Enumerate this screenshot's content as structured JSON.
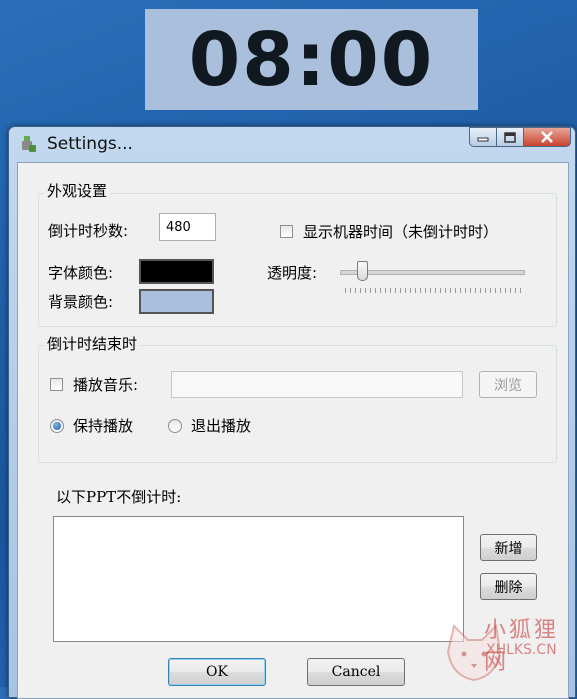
{
  "countdown": {
    "time": "08:00"
  },
  "window": {
    "title": "Settings...",
    "appearance": {
      "group_label": "外观设置",
      "seconds_label": "倒计时秒数:",
      "seconds_value": "480",
      "font_color_label": "字体颜色:",
      "font_color": "#000000",
      "bg_color_label": "背景颜色:",
      "bg_color": "#a9bfdc",
      "show_machine_time_label": "显示机器时间（未倒计时时）",
      "show_machine_time_checked": false,
      "opacity_label": "透明度:",
      "opacity_level": 0.12
    },
    "on_end": {
      "group_label": "倒计时结束时",
      "play_music_label": "播放音乐:",
      "play_music_checked": false,
      "music_path": "",
      "browse_label": "浏览",
      "keep_playing_label": "保持播放",
      "exit_playing_label": "退出播放",
      "selected_option": "keep_playing"
    },
    "ppt": {
      "label": "以下PPT不倒计时:",
      "items": [],
      "add_label": "新增",
      "delete_label": "删除"
    },
    "ok_label": "OK",
    "cancel_label": "Cancel"
  },
  "watermark": {
    "line1": "小狐狸网",
    "line2": "XHLKS.CN"
  }
}
